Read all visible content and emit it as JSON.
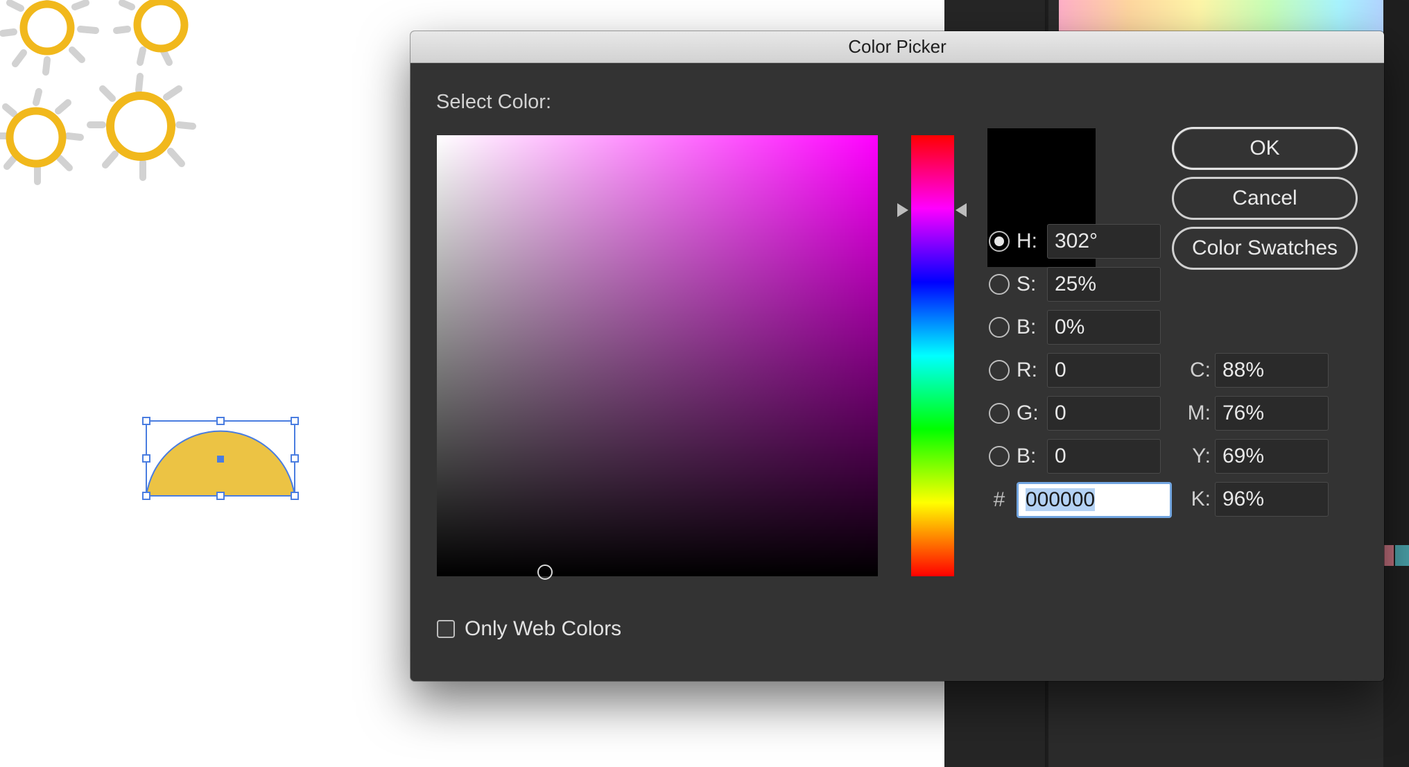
{
  "dialog": {
    "title": "Color Picker",
    "select_color_label": "Select Color:",
    "only_web_colors_label": "Only Web Colors",
    "only_web_colors_checked": false,
    "buttons": {
      "ok": "OK",
      "cancel": "Cancel",
      "color_swatches": "Color Swatches"
    },
    "current_color": "#000000",
    "base_hue_color": "#ff00ff",
    "hsb": [
      {
        "key": "H",
        "label": "H:",
        "value": "302°",
        "selected": true
      },
      {
        "key": "S",
        "label": "S:",
        "value": "25%",
        "selected": false
      },
      {
        "key": "B",
        "label": "B:",
        "value": "0%",
        "selected": false
      }
    ],
    "rgb": [
      {
        "key": "R",
        "label": "R:",
        "value": "0",
        "selected": false
      },
      {
        "key": "G",
        "label": "G:",
        "value": "0",
        "selected": false
      },
      {
        "key": "B",
        "label": "B:",
        "value": "0",
        "selected": false
      }
    ],
    "cmyk": [
      {
        "key": "C",
        "label": "C:",
        "value": "88%"
      },
      {
        "key": "M",
        "label": "M:",
        "value": "76%"
      },
      {
        "key": "Y",
        "label": "Y:",
        "value": "69%"
      },
      {
        "key": "K",
        "label": "K:",
        "value": "96%"
      }
    ],
    "hex": {
      "label": "#",
      "value": "000000"
    }
  },
  "canvas": {
    "flower_center_color": "#f1b81c",
    "flower_petal_color": "#d2d2d2",
    "shape_fill": "#ecc344",
    "selection_color": "#4a7de0"
  }
}
